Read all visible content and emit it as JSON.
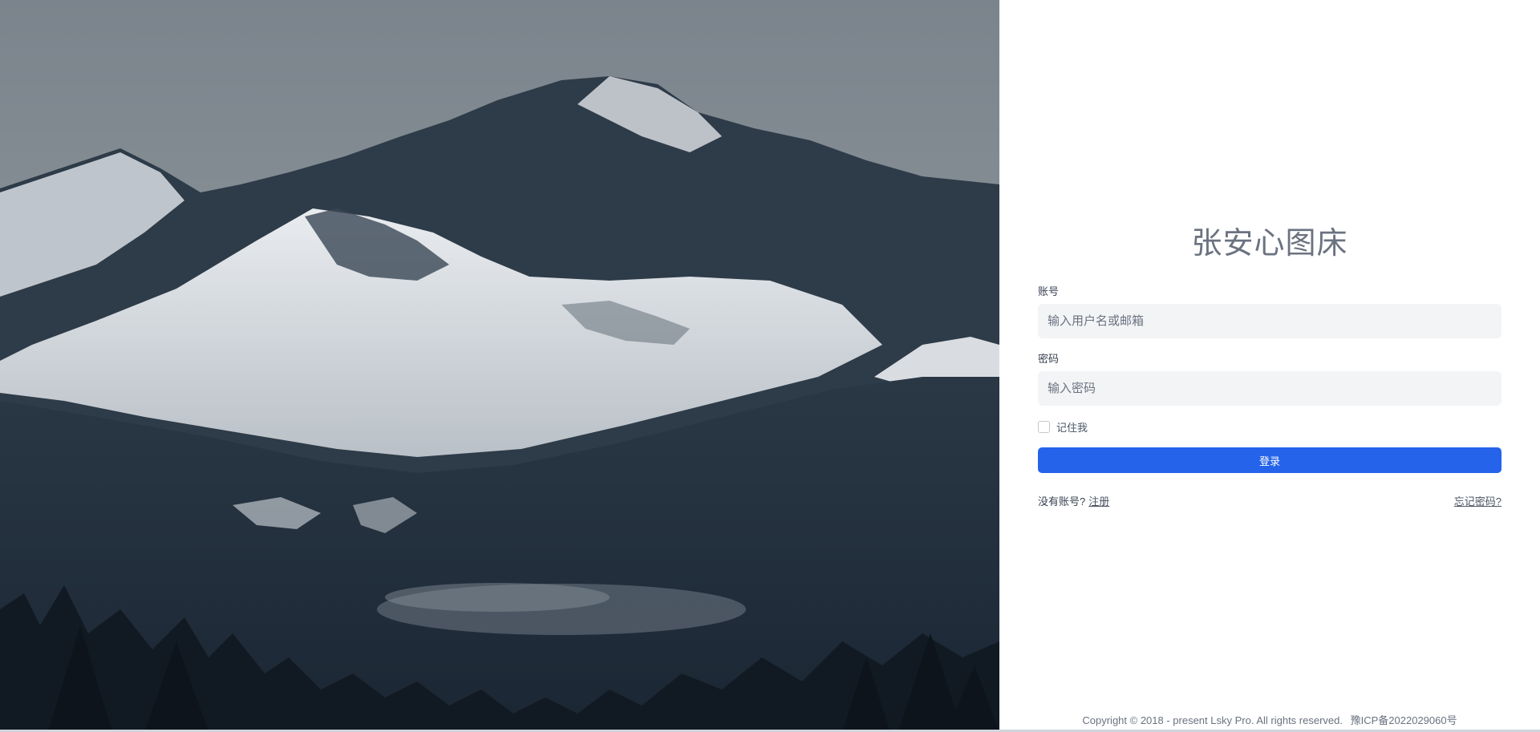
{
  "site": {
    "title": "张安心图床"
  },
  "form": {
    "account_label": "账号",
    "account_placeholder": "输入用户名或邮箱",
    "account_value": "",
    "password_label": "密码",
    "password_placeholder": "输入密码",
    "password_value": "",
    "remember_label": "记住我",
    "remember_checked": false,
    "submit_label": "登录"
  },
  "links": {
    "no_account_text": "没有账号?",
    "register_label": "注册",
    "forgot_label": "忘记密码?"
  },
  "footer": {
    "copyright": "Copyright © 2018 - present Lsky Pro. All rights reserved.",
    "icp": "豫ICP备2022029060号"
  },
  "colors": {
    "primary_button": "#2563eb",
    "input_bg": "#f3f4f6",
    "title": "#6b7280"
  },
  "hero": {
    "image_subject": "snowy mountain landscape"
  }
}
